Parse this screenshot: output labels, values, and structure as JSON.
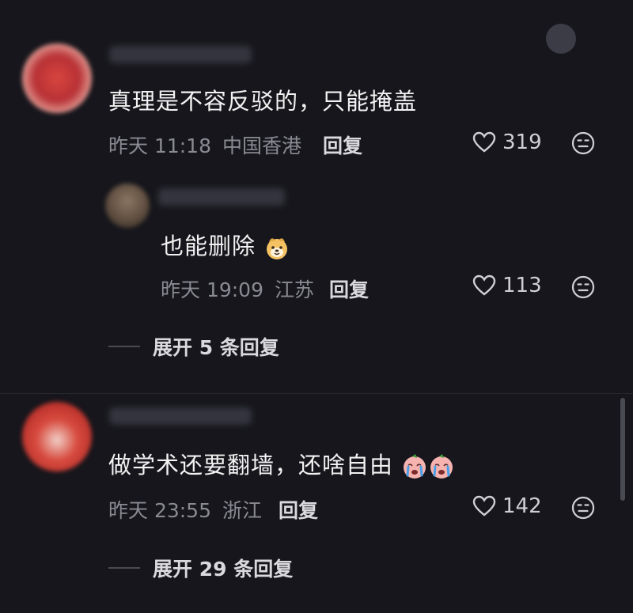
{
  "comments": [
    {
      "text": "真理是不容反驳的，只能掩盖",
      "time": "昨天 11:18",
      "location": "中国香港",
      "reply_label": "回复",
      "likes": "319",
      "avatar_color": "#c0353a"
    },
    {
      "text": "做学术还要翻墙，还啥自由",
      "time": "昨天 23:55",
      "location": "浙江",
      "reply_label": "回复",
      "likes": "142",
      "avatar_color": "#c8392f",
      "expand_label": "展开 29 条回复"
    }
  ],
  "reply": {
    "text": "也能删除",
    "time": "昨天 19:09",
    "location": "江苏",
    "reply_label": "回复",
    "likes": "113",
    "avatar_color": "#6b5a4a"
  },
  "first_expand_label": "展开 5 条回复",
  "icons": {
    "like": "heart-outline-icon",
    "dislike": "neutral-face-icon",
    "emoji_reply": "smiling-dog-emoji",
    "emoji_crying": "crying-face-emoji"
  }
}
